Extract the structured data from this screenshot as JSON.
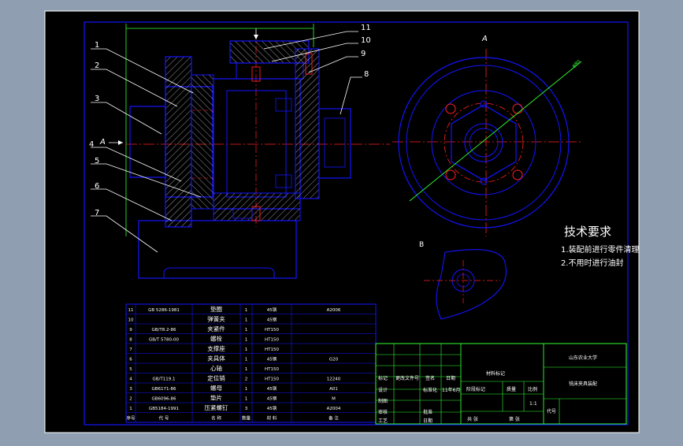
{
  "colors": {
    "background": "#8f9fb1",
    "sheet": "#000000",
    "part": "#1414ff",
    "hatch": "#ffffff",
    "center": "#ff2020",
    "leader": "#ffffff",
    "green": "#33ff33",
    "text": "#ffffff"
  },
  "callouts_left": [
    "1",
    "2",
    "3",
    "4",
    "5",
    "6",
    "7"
  ],
  "callouts_right": [
    "11",
    "10",
    "9",
    "8"
  ],
  "view_labels": {
    "a_left": "A",
    "a_right": "A",
    "b": "B"
  },
  "tech_req": {
    "title": "技术要求",
    "line1": "1.装配前进行零件清理",
    "line2": "2.不用时进行油封"
  },
  "bom": {
    "rows": [
      {
        "no": "11",
        "code": "GB 5286-1981",
        "name": "垫圈",
        "qty": "1",
        "mat": "45钢",
        "note": "A2006"
      },
      {
        "no": "10",
        "code": "",
        "name": "弹簧夹",
        "qty": "1",
        "mat": "45钢",
        "note": ""
      },
      {
        "no": "9",
        "code": "GB/T8.2-86",
        "name": "夹紧件",
        "qty": "1",
        "mat": "HT150",
        "note": ""
      },
      {
        "no": "8",
        "code": "GB/T 5780-00",
        "name": "螺栓",
        "qty": "1",
        "mat": "HT150",
        "note": ""
      },
      {
        "no": "7",
        "code": "",
        "name": "支撑座",
        "qty": "1",
        "mat": "HT150",
        "note": ""
      },
      {
        "no": "6",
        "code": "",
        "name": "夹具体",
        "qty": "1",
        "mat": "45钢",
        "note": "G20"
      },
      {
        "no": "5",
        "code": "",
        "name": "心轴",
        "qty": "1",
        "mat": "HT150",
        "note": ""
      },
      {
        "no": "4",
        "code": "GB/T119.1",
        "name": "定位销",
        "qty": "2",
        "mat": "HT150",
        "note": "12240"
      },
      {
        "no": "3",
        "code": "GB6171-86",
        "name": "螺母",
        "qty": "1",
        "mat": "45钢",
        "note": "A01"
      },
      {
        "no": "2",
        "code": "GB6096-86",
        "name": "垫片",
        "qty": "1",
        "mat": "45钢",
        "note": "M"
      },
      {
        "no": "1",
        "code": "GB5184-1991",
        "name": "压紧螺钉",
        "qty": "3",
        "mat": "45钢",
        "note": "A2004"
      }
    ],
    "header": {
      "no": "序号",
      "code": "代 号",
      "name": "名 称",
      "qty": "数量",
      "mat": "材 料",
      "note": "备 注"
    }
  },
  "title_block": {
    "university": "山东农业大学",
    "drawing_title": "铣床夹具装配",
    "material_mark": "材料标记",
    "stage_mark": "阶段标记",
    "weight": "质量",
    "scale": "比例",
    "scale_value": "1:1",
    "tag": "代号",
    "mark": "标记",
    "count": "处数",
    "file": "更改文件号",
    "sign": "签名",
    "date": "日期",
    "designer": "设计",
    "drawer": "制图",
    "std": "标准化",
    "date_value": "11年6月",
    "check": "审核",
    "process": "工艺",
    "approve": "批准",
    "approve_date": "日期",
    "total": "共 张",
    "sheet": "第 张"
  }
}
